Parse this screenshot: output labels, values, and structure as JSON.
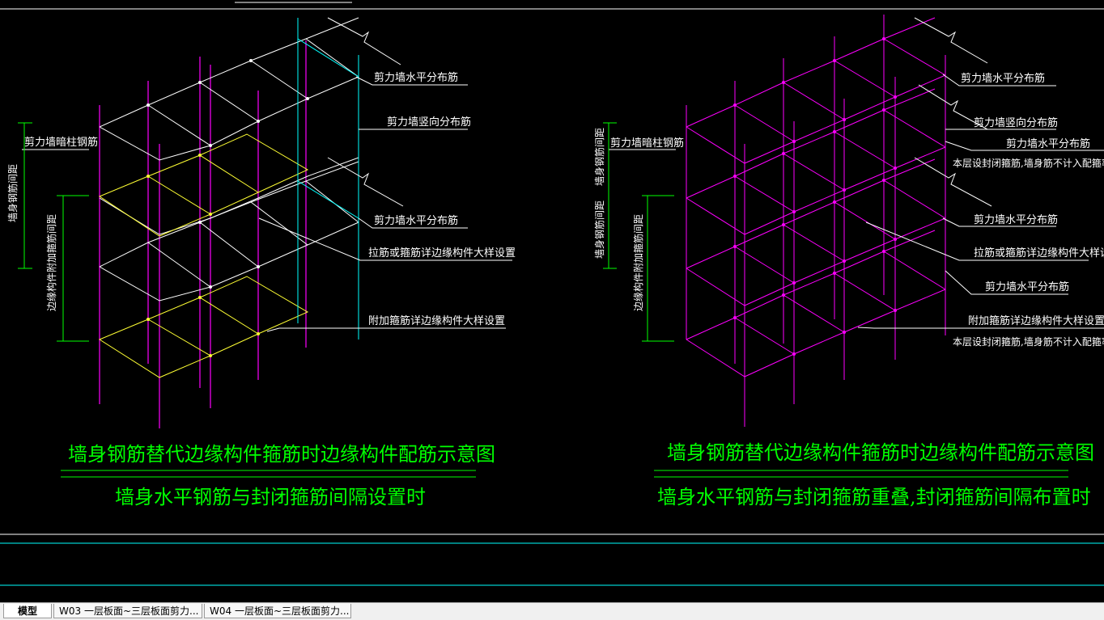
{
  "colors": {
    "background": "#000000",
    "white": "#ffffff",
    "magenta": "#ff00ff",
    "yellow": "#ffff33",
    "cyan": "#00ffff",
    "green": "#00ff00",
    "label": "#ffffff",
    "title": "#00ff00"
  },
  "left_drawing": {
    "labels": {
      "horizontal_top": "剪力墙水平分布筋",
      "vertical": "剪力墙竖向分布筋",
      "horizontal_mid": "剪力墙水平分布筋",
      "tie": "拉筋或箍筋详边缘构件大样设置",
      "additional_stirrup": "附加箍筋详边缘构件大样设置",
      "dark_column": "剪力墙暗柱钢筋",
      "wall_spacing_vertical": "墙身钢筋间距",
      "edge_stirrup_spacing_vertical": "边缘构件附加箍筋间距"
    },
    "title": "墙身钢筋替代边缘构件箍筋时边缘构件配筋示意图",
    "subtitle": "墙身水平钢筋与封闭箍筋间隔设置时"
  },
  "right_drawing": {
    "labels": {
      "horizontal_1": "剪力墙水平分布筋",
      "vertical": "剪力墙竖向分布筋",
      "horizontal_2": "剪力墙水平分布筋",
      "closed_stirrup_note_1": "本层设封闭箍筋,墙身筋不计入配箍率",
      "horizontal_3": "剪力墙水平分布筋",
      "tie": "拉筋或箍筋详边缘构件大样设置",
      "horizontal_4": "剪力墙水平分布筋",
      "additional_stirrup": "附加箍筋详边缘构件大样设置",
      "closed_stirrup_note_2": "本层设封闭箍筋,墙身筋不计入配箍率",
      "dark_column": "剪力墙暗柱钢筋",
      "wall_spacing_vertical": "墙身钢筋间距",
      "edge_stirrup_spacing_vertical": "边缘构件附加箍筋间距"
    },
    "title": "墙身钢筋替代边缘构件箍筋时边缘构件配筋示意图",
    "subtitle": "墙身水平钢筋与封闭箍筋重叠,封闭箍筋间隔布置时"
  },
  "tabs": [
    {
      "label": "模型",
      "active": true
    },
    {
      "label": "W03 一层板面~三层板面剪力...",
      "active": false
    },
    {
      "label": "W04 一层板面~三层板面剪力...",
      "active": false
    }
  ]
}
